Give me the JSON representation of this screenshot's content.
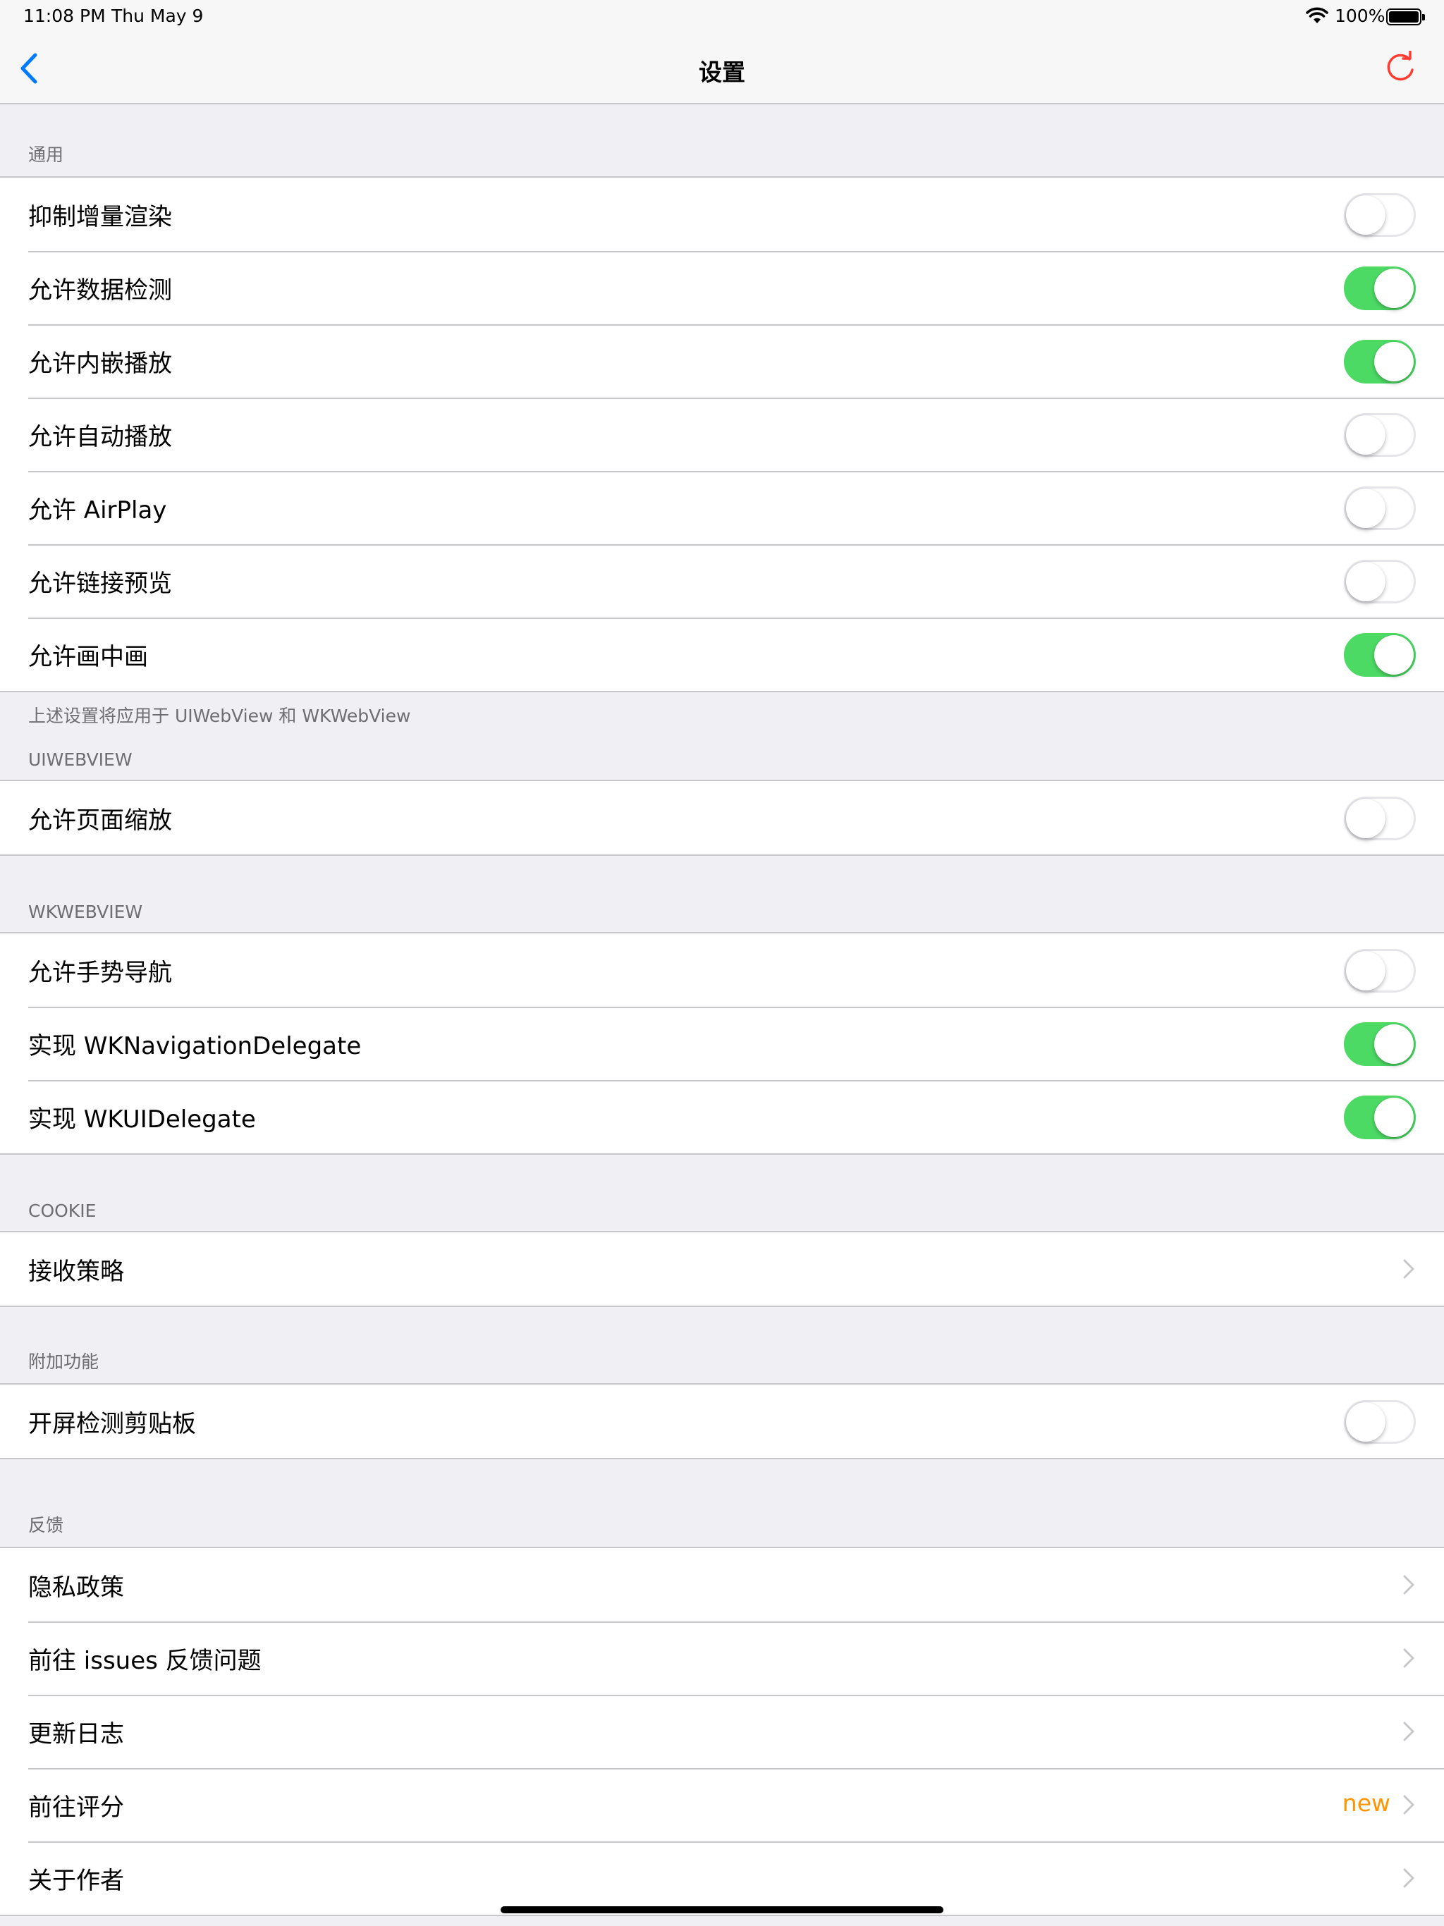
{
  "status": {
    "time": "11:08 PM",
    "date": "Thu May 9",
    "battery": "100%"
  },
  "nav": {
    "title": "设置",
    "back_icon": "chevron-left-icon",
    "refresh_icon": "refresh-icon",
    "accent_color": "#007aff",
    "refresh_color": "#ff3b30"
  },
  "sections": {
    "general": {
      "header": "通用",
      "footer": "上述设置将应用于 UIWebView 和 WKWebView",
      "rows": [
        {
          "label": "抑制增量渲染",
          "on": false
        },
        {
          "label": "允许数据检测",
          "on": true
        },
        {
          "label": "允许内嵌播放",
          "on": true
        },
        {
          "label": "允许自动播放",
          "on": false
        },
        {
          "label": "允许 AirPlay",
          "on": false
        },
        {
          "label": "允许链接预览",
          "on": false
        },
        {
          "label": "允许画中画",
          "on": true
        }
      ]
    },
    "uiwebview": {
      "header": "UIWEBVIEW",
      "rows": [
        {
          "label": "允许页面缩放",
          "on": false
        }
      ]
    },
    "wkwebview": {
      "header": "WKWEBVIEW",
      "rows": [
        {
          "label": "允许手势导航",
          "on": false
        },
        {
          "label": "实现 WKNavigationDelegate",
          "on": true
        },
        {
          "label": "实现 WKUIDelegate",
          "on": true
        }
      ]
    },
    "cookie": {
      "header": "COOKIE",
      "rows": [
        {
          "label": "接收策略"
        }
      ]
    },
    "extras": {
      "header": "附加功能",
      "rows": [
        {
          "label": "开屏检测剪贴板",
          "on": false
        }
      ]
    },
    "feedback": {
      "header": "反馈",
      "rows": [
        {
          "label": "隐私政策"
        },
        {
          "label": "前往 issues 反馈问题"
        },
        {
          "label": "更新日志"
        },
        {
          "label": "前往评分",
          "badge": "new"
        },
        {
          "label": "关于作者"
        }
      ]
    }
  },
  "colors": {
    "toggle_on": "#4cd964",
    "badge": "#ff9500",
    "background": "#efeff4"
  }
}
